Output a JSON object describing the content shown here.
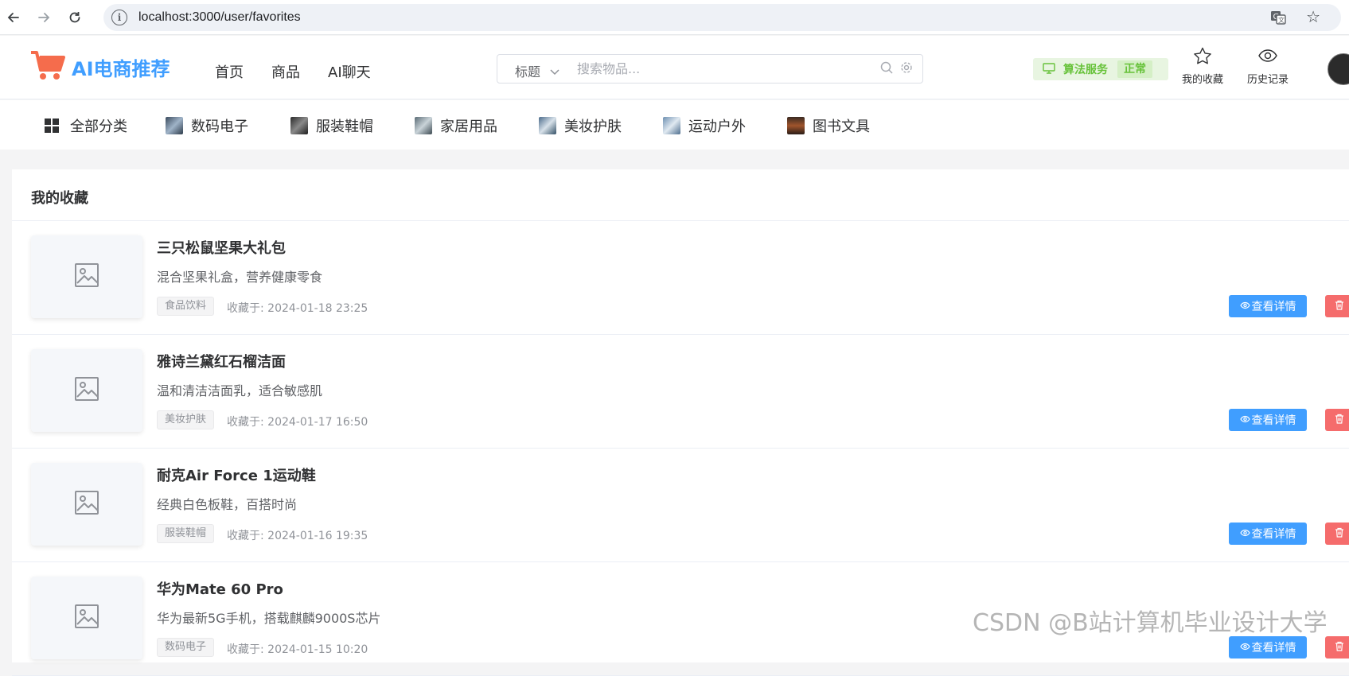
{
  "browser": {
    "url": "localhost:3000/user/favorites"
  },
  "header": {
    "logo_text": "AI电商推荐",
    "nav": [
      "首页",
      "商品",
      "AI聊天"
    ],
    "search": {
      "type_label": "标题",
      "placeholder": "搜索物品..."
    },
    "algo": {
      "label": "算法服务",
      "status": "正常",
      "color": "#67c23a"
    },
    "favorites_label": "我的收藏",
    "history_label": "历史记录"
  },
  "categories": [
    {
      "label": "全部分类",
      "icon": "grid-icon"
    },
    {
      "label": "数码电子",
      "icon": "thumbnail"
    },
    {
      "label": "服装鞋帽",
      "icon": "thumbnail"
    },
    {
      "label": "家居用品",
      "icon": "thumbnail"
    },
    {
      "label": "美妆护肤",
      "icon": "thumbnail"
    },
    {
      "label": "运动户外",
      "icon": "thumbnail"
    },
    {
      "label": "图书文具",
      "icon": "thumbnail"
    }
  ],
  "favorites": {
    "title": "我的收藏",
    "detail_label": "查看详情",
    "delete_label": "删除",
    "items": [
      {
        "name": "三只松鼠坚果大礼包",
        "desc": "混合坚果礼盒，营养健康零食",
        "tag": "食品饮料",
        "date": "收藏于: 2024-01-18 23:25"
      },
      {
        "name": "雅诗兰黛红石榴洁面",
        "desc": "温和清洁洁面乳，适合敏感肌",
        "tag": "美妆护肤",
        "date": "收藏于: 2024-01-17 16:50"
      },
      {
        "name": "耐克Air Force 1运动鞋",
        "desc": "经典白色板鞋，百搭时尚",
        "tag": "服装鞋帽",
        "date": "收藏于: 2024-01-16 19:35"
      },
      {
        "name": "华为Mate 60 Pro",
        "desc": "华为最新5G手机，搭载麒麟9000S芯片",
        "tag": "数码电子",
        "date": "收藏于: 2024-01-15 10:20"
      }
    ]
  },
  "watermark": "CSDN @B站计算机毕业设计大学",
  "colors": {
    "primary": "#409eff",
    "danger": "#f56c6c",
    "success": "#67c23a"
  }
}
